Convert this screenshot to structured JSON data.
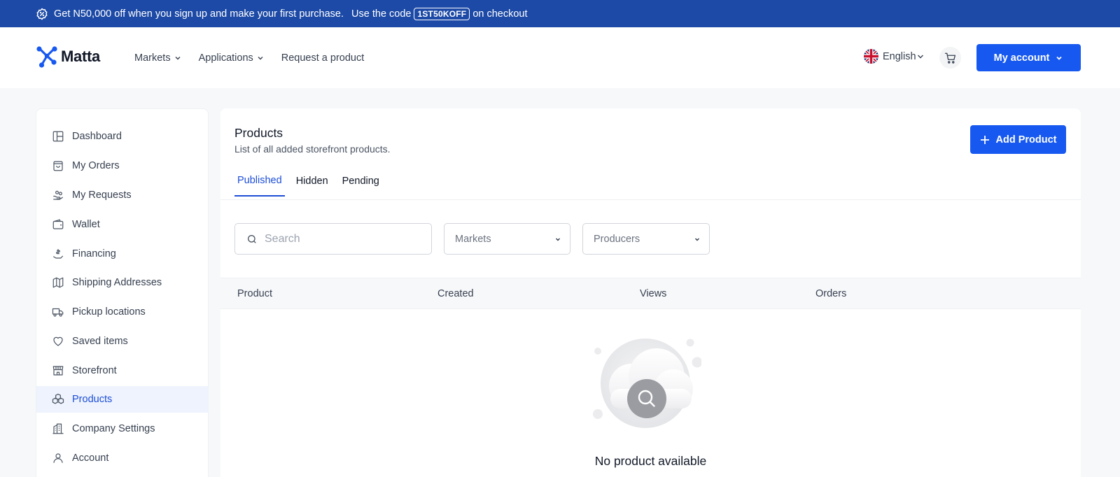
{
  "promo": {
    "text_before": "Get N50,000 off when you sign up and make your first purchase.",
    "text_code_lead": "Use the code",
    "code": "1ST50KOFF",
    "text_after": "on checkout"
  },
  "header": {
    "logo_text": "Matta",
    "nav": [
      {
        "label": "Markets",
        "has_dropdown": true
      },
      {
        "label": "Applications",
        "has_dropdown": true
      },
      {
        "label": "Request a product",
        "has_dropdown": false
      }
    ],
    "language": "English",
    "account_label": "My account"
  },
  "sidebar": {
    "items": [
      {
        "label": "Dashboard",
        "icon": "layout-icon"
      },
      {
        "label": "My Orders",
        "icon": "shopping-bag-icon"
      },
      {
        "label": "My Requests",
        "icon": "hand-coins-icon"
      },
      {
        "label": "Wallet",
        "icon": "wallet-icon"
      },
      {
        "label": "Financing",
        "icon": "financing-icon"
      },
      {
        "label": "Shipping Addresses",
        "icon": "map-icon"
      },
      {
        "label": "Pickup locations",
        "icon": "truck-icon"
      },
      {
        "label": "Saved items",
        "icon": "heart-icon"
      },
      {
        "label": "Storefront",
        "icon": "store-icon"
      },
      {
        "label": "Products",
        "icon": "boxes-icon",
        "active": true
      },
      {
        "label": "Company Settings",
        "icon": "building-icon"
      },
      {
        "label": "Account",
        "icon": "user-icon"
      }
    ]
  },
  "main": {
    "title": "Products",
    "subtitle": "List of all added storefront products.",
    "add_label": "Add Product",
    "tabs": [
      {
        "label": "Published",
        "active": true
      },
      {
        "label": "Hidden"
      },
      {
        "label": "Pending"
      }
    ],
    "search_placeholder": "Search",
    "filters": {
      "markets": "Markets",
      "producers": "Producers"
    },
    "columns": [
      "Product",
      "Created",
      "Views",
      "Orders"
    ],
    "empty_text": "No product available"
  },
  "colors": {
    "promo_bg": "#1d4aa6",
    "primary": "#1759f0",
    "active_text": "#1d4ed8",
    "active_bg": "#eef3fd"
  }
}
